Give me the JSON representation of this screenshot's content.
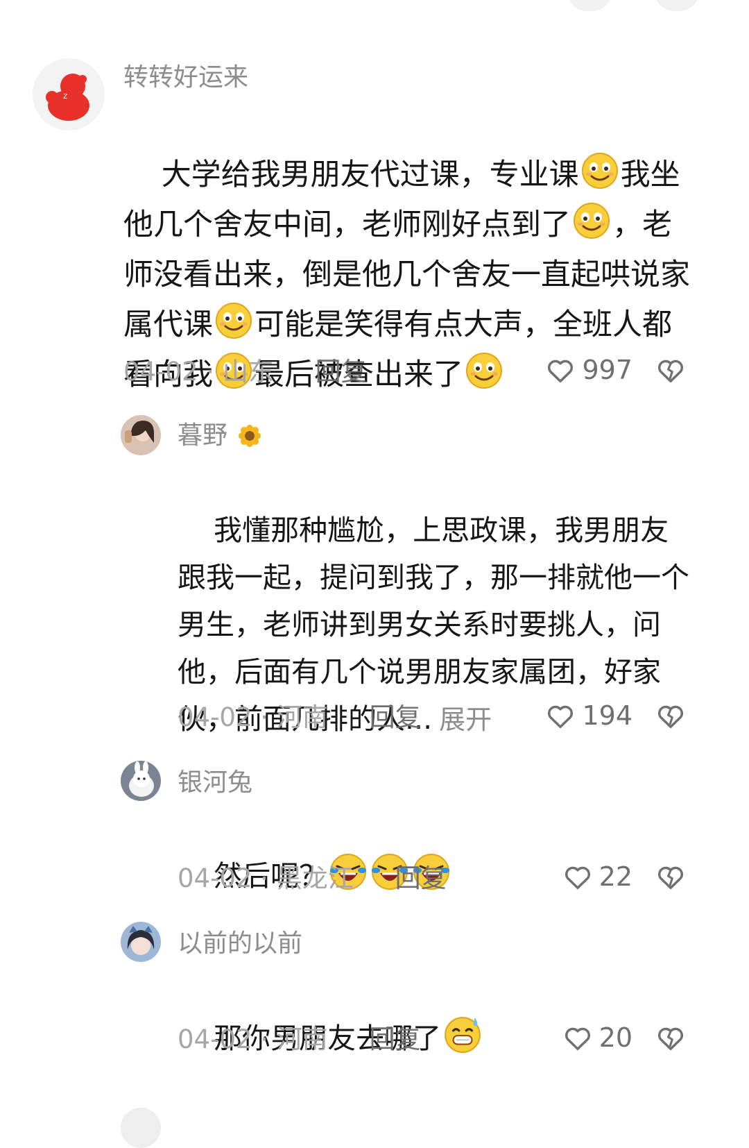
{
  "comments": [
    {
      "username": "转转好运来",
      "segments": [
        "大学给我男朋友代过课，专业课",
        "我坐他几个舍友中间，老师刚好点到了",
        "，老师没看出来，倒是他几个舍友一直起哄说家属代课",
        "可能是笑得有点大声，全班人都看向我",
        "最后被查出来了"
      ],
      "date": "04-02",
      "location": "山东",
      "reply_label": "回复",
      "likes": "997"
    },
    {
      "username": "暮野",
      "text": "我懂那种尴尬，上思政课，我男朋友跟我一起，提问到我了，那一排就他一个男生，老师讲到男女关系时要挑人，问他，后面有几个说男朋友家属团，好家伙，前面几排的人...",
      "expand_label": "展开",
      "date": "04-02",
      "location": "河南",
      "reply_label": "回复",
      "likes": "194"
    },
    {
      "username": "银河兔",
      "text": "然后呢？",
      "date": "04-02",
      "location": "黑龙江",
      "reply_label": "回复",
      "likes": "22"
    },
    {
      "username": "以前的以前",
      "text": "那你男朋友去哪了",
      "date": "04-02",
      "location": "河南",
      "reply_label": "回复",
      "likes": "20"
    }
  ],
  "meta_separator": "·",
  "icons": {
    "like": "heart-outline-icon",
    "dislike": "broken-heart-icon",
    "emoji_smile": "sly-smile-emoji-icon",
    "emoji_laugh": "laughing-crying-emoji-icon",
    "emoji_sweat": "grinning-sweat-emoji-icon",
    "sunflower": "sunflower-icon"
  }
}
